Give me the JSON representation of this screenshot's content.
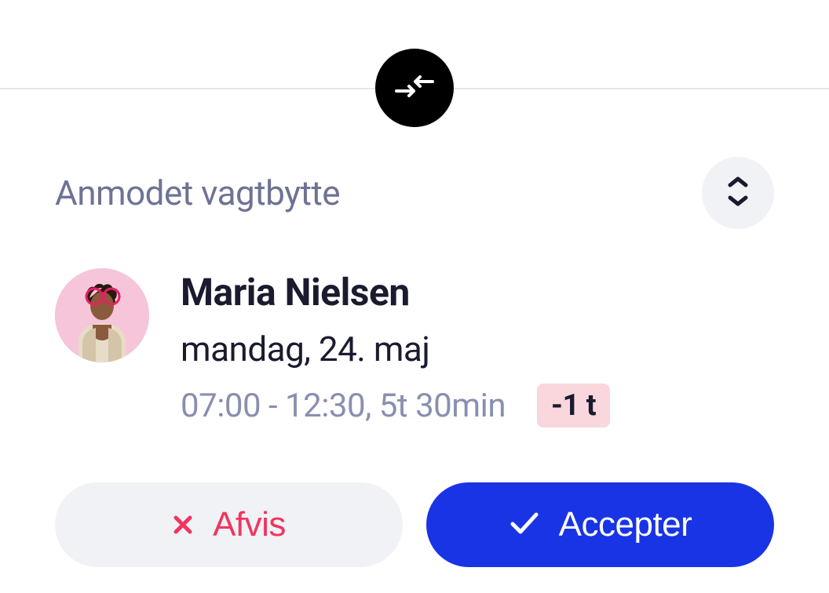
{
  "section": {
    "title": "Anmodet vagtbytte"
  },
  "person": {
    "name": "Maria Nielsen",
    "date": "mandag, 24. maj",
    "time": "07:00 - 12:30, 5t 30min",
    "delta": "-1 t"
  },
  "buttons": {
    "reject": "Afvis",
    "accept": "Accepter"
  },
  "icons": {
    "swap": "swap-icon",
    "expand": "expand-collapse-icon",
    "close": "close-icon",
    "check": "check-icon"
  },
  "colors": {
    "accent": "#1934e5",
    "danger": "#f0365e",
    "badge_bg": "#f9d7dc",
    "muted": "#8a8fb0"
  }
}
